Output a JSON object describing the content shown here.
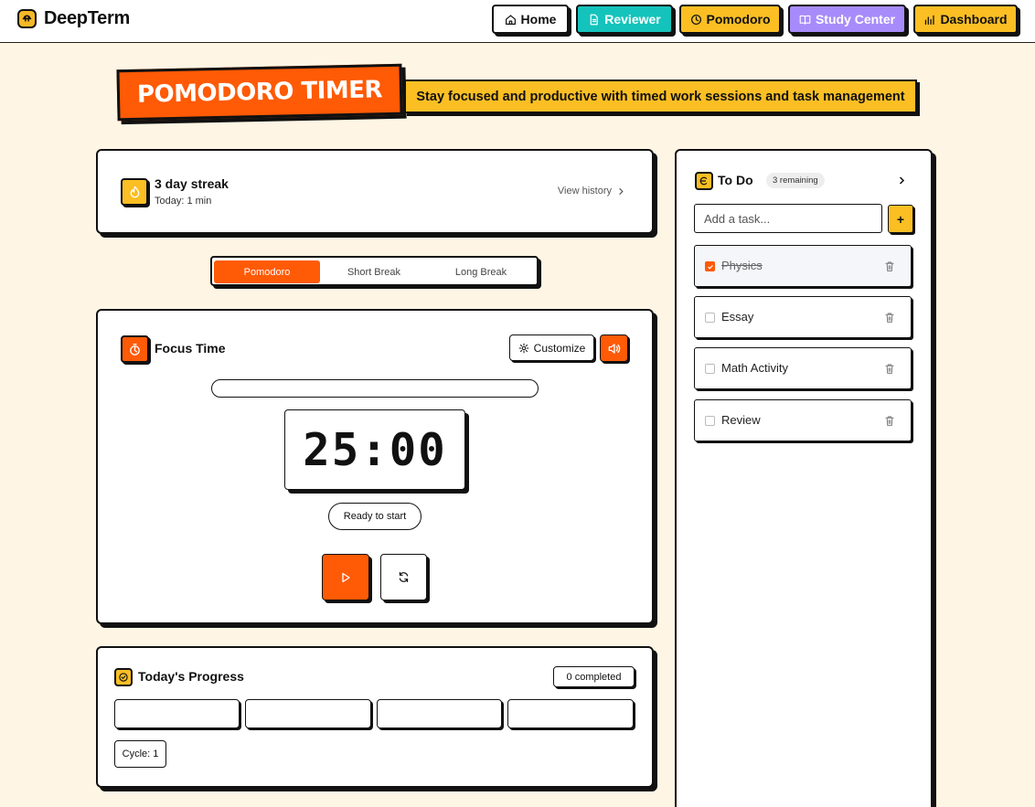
{
  "app": {
    "name": "DeepTerm"
  },
  "nav": [
    {
      "label": "Home",
      "icon": "home-icon",
      "bg": "#ffffff",
      "color": "#111111"
    },
    {
      "label": "Reviewer",
      "icon": "document-icon",
      "bg": "#14c3bb",
      "color": "#ffffff"
    },
    {
      "label": "Pomodoro",
      "icon": "clock-icon",
      "bg": "#fbbf24",
      "color": "#111111"
    },
    {
      "label": "Study Center",
      "icon": "book-icon",
      "bg": "#a78bfa",
      "color": "#ffffff"
    },
    {
      "label": "Dashboard",
      "icon": "chart-icon",
      "bg": "#fbbf24",
      "color": "#111111"
    }
  ],
  "banner": {
    "title": "POMODORO TIMER",
    "subtitle": "Stay focused and productive with timed work sessions and task management"
  },
  "streak": {
    "title": "3 day streak",
    "today": "Today: 1 min",
    "view_history": "View history"
  },
  "modes": [
    {
      "label": "Pomodoro",
      "active": true
    },
    {
      "label": "Short Break",
      "active": false
    },
    {
      "label": "Long Break",
      "active": false
    }
  ],
  "focus": {
    "title": "Focus Time",
    "customize_label": "Customize",
    "progress_fraction": 0,
    "time": "25:00",
    "status": "Ready to start"
  },
  "today": {
    "title": "Today's Progress",
    "completed": "0 completed",
    "sessions_total": 4,
    "sessions_done": 0,
    "cycle": "Cycle: 1"
  },
  "todo": {
    "title": "To Do",
    "remaining": "3 remaining",
    "input_placeholder": "Add a task...",
    "add_label": "+",
    "tasks": [
      {
        "label": "Physics",
        "done": true
      },
      {
        "label": "Essay",
        "done": false
      },
      {
        "label": "Math Activity",
        "done": false
      },
      {
        "label": "Review",
        "done": false
      }
    ]
  },
  "colors": {
    "accent": "#ff5a05",
    "yellow": "#fbbf24",
    "teal": "#14c3bb",
    "purple": "#a78bfa",
    "background": "#fff5e4"
  }
}
